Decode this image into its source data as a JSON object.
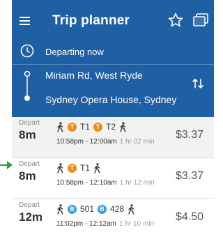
{
  "header": {
    "title": "Trip planner",
    "departing": "Departing now",
    "from": "Miriam Rd, West Ryde",
    "to": "Sydney Opera House, Sydney"
  },
  "colors": {
    "header_bg": "#1f5fa3",
    "train_badge": "#f08a14",
    "bus_badge": "#2aa3e0"
  },
  "trips": [
    {
      "depart_label": "Depart",
      "depart_in": "8m",
      "legs": [
        {
          "type": "walk",
          "icon": "walk-icon"
        },
        {
          "type": "train",
          "badge": "T",
          "route": "T1"
        },
        {
          "type": "train",
          "badge": "T",
          "route": "T2"
        },
        {
          "type": "walk",
          "icon": "walk-icon"
        }
      ],
      "time_range": "10:58pm - 12:00am",
      "duration": "1 hr 02 min",
      "price": "$3.37"
    },
    {
      "depart_label": "Depart",
      "depart_in": "8m",
      "legs": [
        {
          "type": "walk",
          "icon": "walk-icon"
        },
        {
          "type": "train",
          "badge": "T",
          "route": "T1"
        },
        {
          "type": "walk",
          "icon": "walk-icon"
        }
      ],
      "time_range": "10:58pm - 12:10am",
      "duration": "1 hr 12 min",
      "price": "$3.37"
    },
    {
      "depart_label": "Depart",
      "depart_in": "12m",
      "legs": [
        {
          "type": "walk",
          "icon": "walk-icon"
        },
        {
          "type": "bus",
          "badge": "B",
          "route": "501"
        },
        {
          "type": "bus",
          "badge": "B",
          "route": "428"
        },
        {
          "type": "walk",
          "icon": "walk-icon"
        }
      ],
      "time_range": "11:02pm - 12:12am",
      "duration": "1 hr 10 min",
      "price": "$4.50"
    }
  ]
}
